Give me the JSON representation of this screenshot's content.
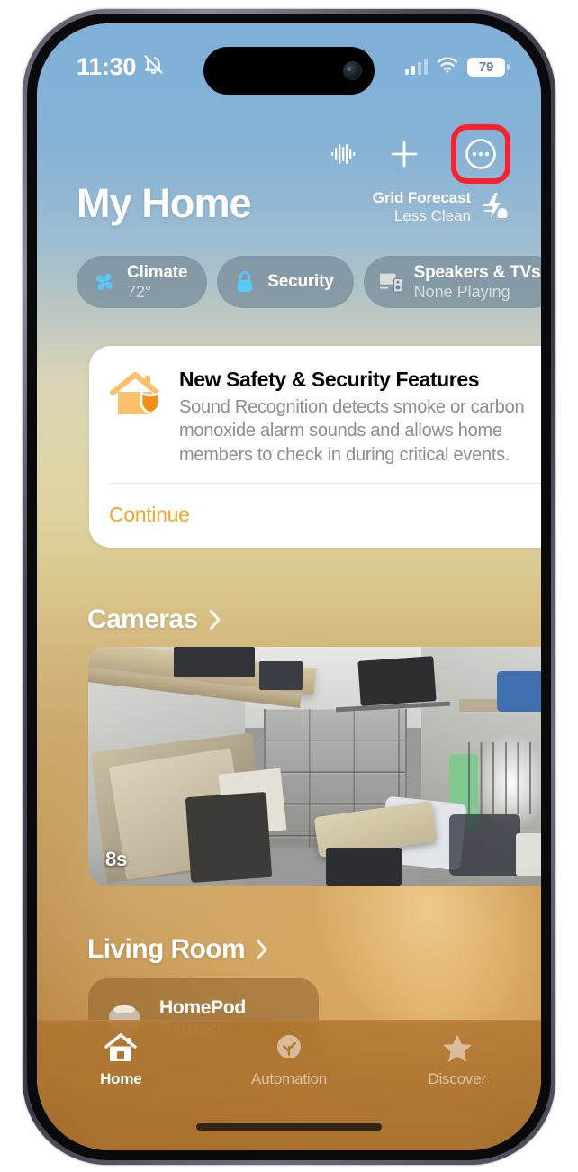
{
  "status_bar": {
    "time": "11:30",
    "silent_icon": "bell-slash-icon",
    "cellular_icon": "cellular-bars-icon",
    "wifi_icon": "wifi-icon",
    "battery_level": "79"
  },
  "top_actions": {
    "intercom_icon": "intercom-waveform-icon",
    "add_icon": "plus-icon",
    "more_icon": "ellipsis-circle-icon",
    "highlight_color": "#f6222e"
  },
  "header": {
    "title": "My Home",
    "grid_forecast_label": "Grid Forecast",
    "grid_forecast_value": "Less Clean",
    "grid_forecast_icon": "bolt-cloud-icon"
  },
  "pills": [
    {
      "title": "Climate",
      "subtitle": "72°",
      "icon": "fan-icon",
      "icon_color": "#5ac8f5"
    },
    {
      "title": "Security",
      "subtitle": "",
      "icon": "lock-icon",
      "icon_color": "#5ac8f5"
    },
    {
      "title": "Speakers & TVs",
      "subtitle": "None Playing",
      "icon": "tv-speaker-icon",
      "icon_color": "#dcdcdc"
    }
  ],
  "safety_card": {
    "icon": "house-shield-icon",
    "title": "New Safety & Security Features",
    "description": "Sound Recognition detects smoke or carbon monoxide alarm sounds and allows home members to check in during critical events.",
    "action_label": "Continue",
    "action_color": "#f5a623"
  },
  "cameras_section": {
    "title": "Cameras",
    "chevron_icon": "chevron-right-icon",
    "tile": {
      "timestamp": "8s",
      "scene": "garage-interior-camera-view"
    }
  },
  "living_room_section": {
    "title": "Living Room",
    "chevron_icon": "chevron-right-icon",
    "accessory": {
      "name": "HomePod",
      "status": "Paused",
      "icon": "homepod-icon"
    }
  },
  "tab_bar": {
    "tabs": [
      {
        "label": "Home",
        "icon": "house-icon",
        "active": true
      },
      {
        "label": "Automation",
        "icon": "clock-check-icon",
        "active": false
      },
      {
        "label": "Discover",
        "icon": "star-icon",
        "active": false
      }
    ]
  }
}
